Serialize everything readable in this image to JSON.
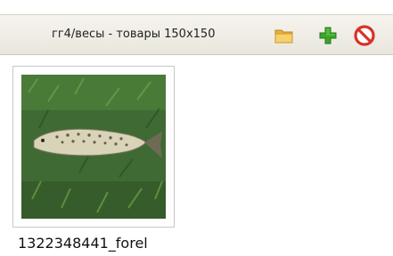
{
  "toolbar": {
    "title": "гг4/весы - товары 150х150",
    "buttons": [
      {
        "icon": "folder-icon",
        "color": "#f2c14e"
      },
      {
        "icon": "plus-icon",
        "color": "#3aa52a"
      },
      {
        "icon": "forbidden-icon",
        "color": "#d6322a"
      }
    ]
  },
  "gallery": {
    "items": [
      {
        "caption": "1322348441_forel"
      }
    ]
  }
}
